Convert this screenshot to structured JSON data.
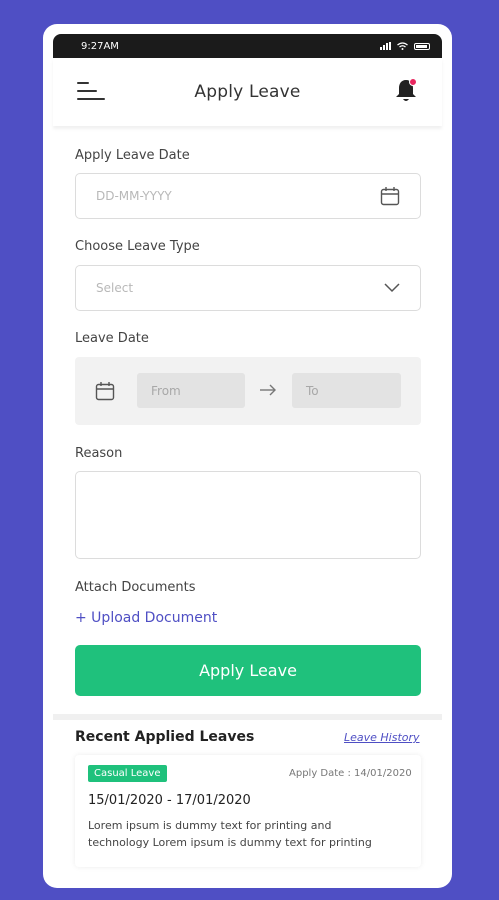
{
  "status_bar": {
    "time": "9:27AM"
  },
  "app_bar": {
    "title": "Apply Leave"
  },
  "form": {
    "apply_leave_date": {
      "label": "Apply Leave Date",
      "placeholder": "DD-MM-YYYY"
    },
    "leave_type": {
      "label": "Choose Leave Type",
      "selected": "Select"
    },
    "leave_date": {
      "label": "Leave Date",
      "from_placeholder": "From",
      "to_placeholder": "To"
    },
    "reason": {
      "label": "Reason",
      "value": ""
    },
    "attach": {
      "label": "Attach Documents",
      "upload_link": "+ Upload Document"
    },
    "submit_label": "Apply Leave"
  },
  "recent": {
    "title": "Recent Applied Leaves",
    "history_link": "Leave History",
    "items": [
      {
        "type_badge": "Casual Leave",
        "apply_date": "Apply Date : 14/01/2020",
        "date_range": "15/01/2020 - 17/01/2020",
        "description": "Lorem ipsum is dummy text for printing and technology Lorem ipsum is dummy text for printing"
      }
    ]
  },
  "colors": {
    "background": "#4f4fc4",
    "accent": "#1fc17c",
    "link": "#4f4fc4",
    "notification": "#e8265e"
  },
  "icons": [
    "menu-icon",
    "bell-icon",
    "calendar-icon",
    "chevron-down-icon",
    "arrow-right-icon",
    "wifi-icon",
    "signal-icon",
    "battery-icon"
  ]
}
